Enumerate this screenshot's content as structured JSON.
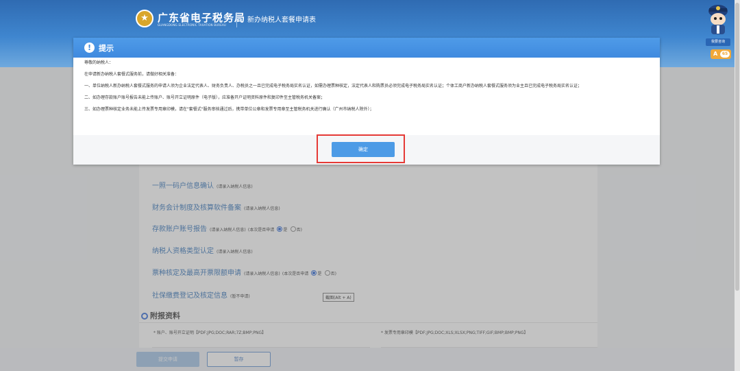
{
  "header": {
    "brand": "广东省电子税务局",
    "brand_en": "GUANGDONG ELECTRONIC TAXATION BUREAU",
    "page_title": "新办纳税人套餐申请表",
    "mascot_label": "我要咨询",
    "notify_letter": "A",
    "notify_count": "65"
  },
  "form": {
    "items": [
      {
        "label": "一照一码户信息确认",
        "note": "(请录入纳税人信息)"
      },
      {
        "label": "财务会计制度及核算软件备案",
        "note": "(请录入纳税人信息)"
      },
      {
        "label": "存款账户账号报告",
        "note": "(请录入纳税人信息)",
        "question": "(本次是否申请",
        "yes": "是",
        "no": "否)"
      },
      {
        "label": "纳税人资格类型认定",
        "note": "(请录入纳税人信息)"
      },
      {
        "label": "票种核定及最高开票限额申请",
        "note": "(请录入纳税人信息)",
        "question": "(本次是否申请",
        "yes": "是",
        "no": "否)"
      },
      {
        "label": "社保缴费登记及核定信息",
        "note": "(暂不申请)"
      }
    ],
    "tooltip": "截图(Alt + A)",
    "attachments_title": "附报资料",
    "attachment_left": "* 账户、账号开立证明【PDF;JPG;DOC;RAR;7Z;BMP;PNG】",
    "attachment_right": "* 发票专用章印模【PDF;JPG;DOC;XLS;XLSX;PNG;TIFF;GIF;BMP;BMP;PNG】",
    "submit_label": "提交申请",
    "save_label": "暂存"
  },
  "modal": {
    "title": "提示",
    "greeting": "尊敬的纳税人：",
    "intro": "在申请新办纳税人套餐式服务前，请做好相关准备：",
    "p1": "一、单位纳税人新办纳税人套餐式服务的申请人须为企业法定代表人、财务负责人、办税员之一且已完成电子税务局实名认证，如需办理票种核定，法定代表人和购票员必须完成电子税务局实名认证；个体工商户新办纳税人套餐式服务须为业主且已完成电子税务局实名认证；",
    "p2": "二、如办理存款账户账号报告未能上传账户、账号开立证明原件（电子版），应准备开户证明资料原件和复印件至主管税务机关备案；",
    "p3": "三、如办理票种核定业务未能上传发票专用章印模，请在\"套餐式\"服务审核通过后，携带单位公章和发票专用章至主管税务机关进行确认（广州市纳税人除外）；",
    "ok_label": "确定"
  }
}
